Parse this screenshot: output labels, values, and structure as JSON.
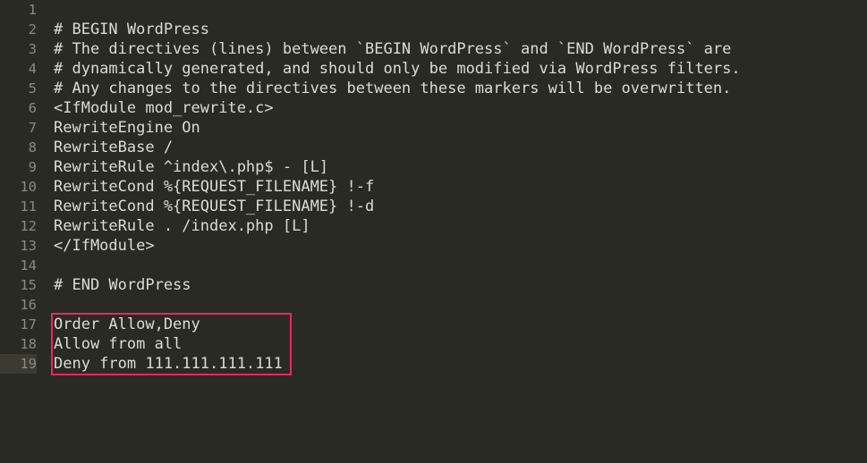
{
  "editor": {
    "background_color": "#2a2a24",
    "text_color": "#dcdcd4",
    "gutter_text_color": "#8a8a80",
    "active_line_background": "#3b3b31",
    "active_line_number": 19,
    "first_line_number": 1,
    "last_line_number": 19
  },
  "annotation": {
    "type": "rectangle-highlight",
    "border_color": "#e8285e",
    "covers_lines": "17-19"
  },
  "lines": [
    {
      "number": "1",
      "text": ""
    },
    {
      "number": "2",
      "text": "# BEGIN WordPress"
    },
    {
      "number": "3",
      "text": "# The directives (lines) between `BEGIN WordPress` and `END WordPress` are"
    },
    {
      "number": "4",
      "text": "# dynamically generated, and should only be modified via WordPress filters."
    },
    {
      "number": "5",
      "text": "# Any changes to the directives between these markers will be overwritten."
    },
    {
      "number": "6",
      "text": "<IfModule mod_rewrite.c>"
    },
    {
      "number": "7",
      "text": "RewriteEngine On"
    },
    {
      "number": "8",
      "text": "RewriteBase /"
    },
    {
      "number": "9",
      "text": "RewriteRule ^index\\.php$ - [L]"
    },
    {
      "number": "10",
      "text": "RewriteCond %{REQUEST_FILENAME} !-f"
    },
    {
      "number": "11",
      "text": "RewriteCond %{REQUEST_FILENAME} !-d"
    },
    {
      "number": "12",
      "text": "RewriteRule . /index.php [L]"
    },
    {
      "number": "13",
      "text": "</IfModule>"
    },
    {
      "number": "14",
      "text": ""
    },
    {
      "number": "15",
      "text": "# END WordPress"
    },
    {
      "number": "16",
      "text": ""
    },
    {
      "number": "17",
      "text": "Order Allow,Deny"
    },
    {
      "number": "18",
      "text": "Allow from all"
    },
    {
      "number": "19",
      "text": "Deny from 111.111.111.111"
    }
  ]
}
